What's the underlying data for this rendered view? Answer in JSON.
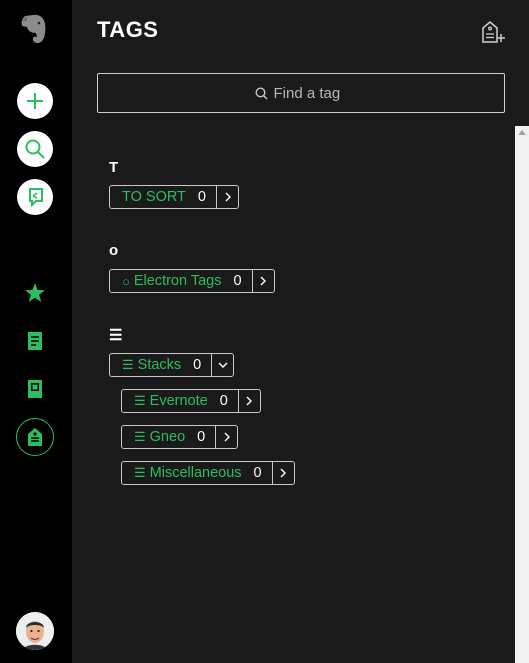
{
  "header": {
    "title": "TAGS"
  },
  "search": {
    "placeholder": "Find a tag"
  },
  "groups": [
    {
      "letter": "T"
    },
    {
      "letter": "o"
    },
    {
      "letter": "☰"
    }
  ],
  "tags": [
    {
      "name": "TO SORT",
      "count": "0",
      "prefix": ""
    },
    {
      "name": "Electron Tags",
      "count": "0",
      "prefix": "○"
    },
    {
      "name": "Stacks",
      "count": "0",
      "prefix": "☰"
    },
    {
      "name": "Evernote",
      "count": "0",
      "prefix": "☰"
    },
    {
      "name": "Gneo",
      "count": "0",
      "prefix": "☰"
    },
    {
      "name": "Miscellaneous",
      "count": "0",
      "prefix": "☰"
    }
  ],
  "colors": {
    "accent": "#2dbe60",
    "sidebar": "#000000",
    "panel": "#1a1a1a"
  }
}
